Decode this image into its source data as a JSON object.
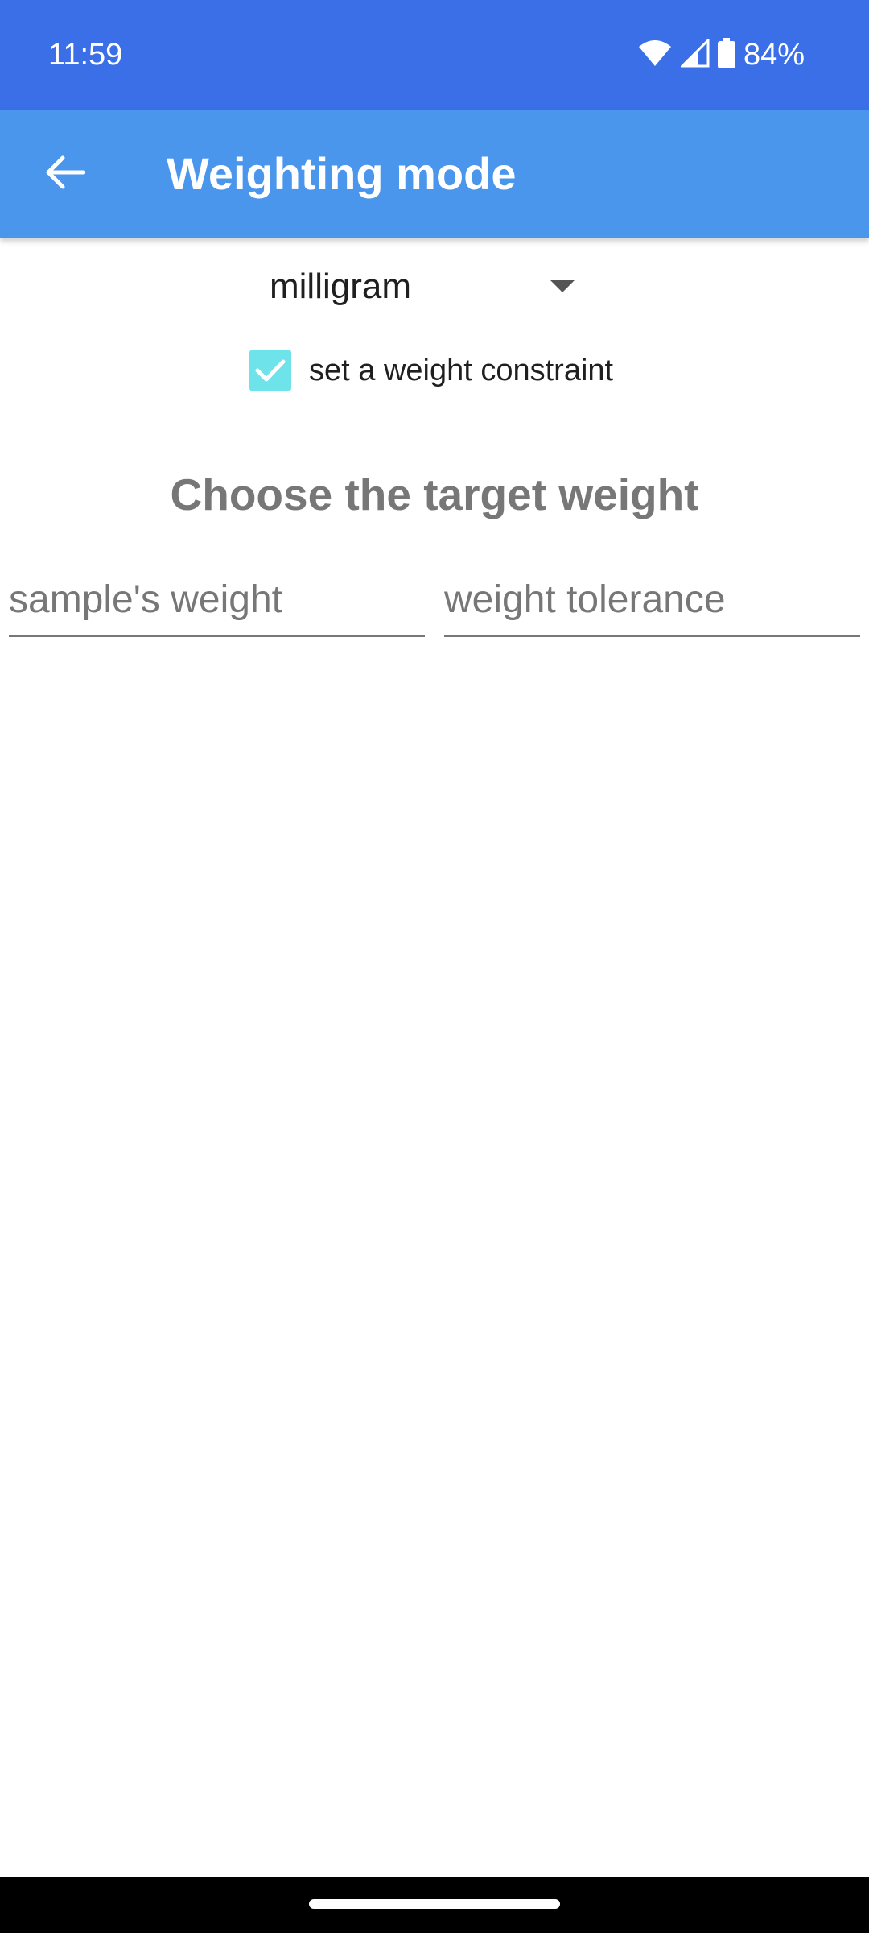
{
  "status_bar": {
    "time": "11:59",
    "battery": "84%",
    "icons": [
      "wifi-icon",
      "cell-signal-icon",
      "battery-icon"
    ]
  },
  "app_bar": {
    "title": "Weighting mode",
    "back_icon": "arrow-back-icon"
  },
  "unit_spinner": {
    "selected": "milligram"
  },
  "constraint": {
    "label": "set a weight constraint",
    "checked": true
  },
  "section": {
    "title": "Choose the target weight"
  },
  "fields": {
    "sample_weight": {
      "value": "",
      "placeholder": "sample's weight"
    },
    "weight_tolerance": {
      "value": "",
      "placeholder": "weight tolerance"
    }
  },
  "colors": {
    "status_bar": "#3b6fe8",
    "app_bar": "#4996ec",
    "checkbox": "#6fe3ea"
  }
}
